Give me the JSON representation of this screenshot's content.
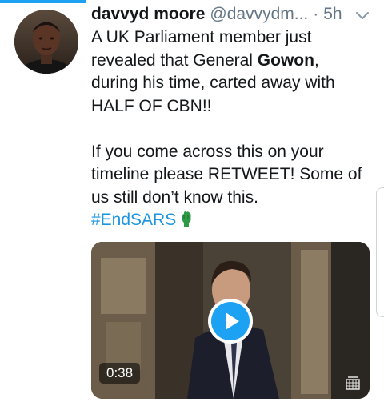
{
  "tweet": {
    "display_name": "davvyd moore",
    "handle": "@davvydm...",
    "separator": "·",
    "time": "5h",
    "text_line1_pre": "A UK Parliament member just revealed that General ",
    "text_line1_bold": "Gowon",
    "text_line1_post": ", during his time, carted away with HALF OF CBN!!",
    "text_line2": "If you come across this on your timeline please RETWEET! Some of us still don’t know this.",
    "hashtag": "#EndSARS",
    "icons": {
      "caret": "chevron-down-icon",
      "emoji": "raised-fist-icon",
      "play": "play-icon"
    }
  },
  "media": {
    "duration": "0:38"
  },
  "colors": {
    "accent": "#1da1f2",
    "hashtag": "#1b95e0",
    "secondary_text": "#657786",
    "emoji_green": "#2e9b44"
  }
}
